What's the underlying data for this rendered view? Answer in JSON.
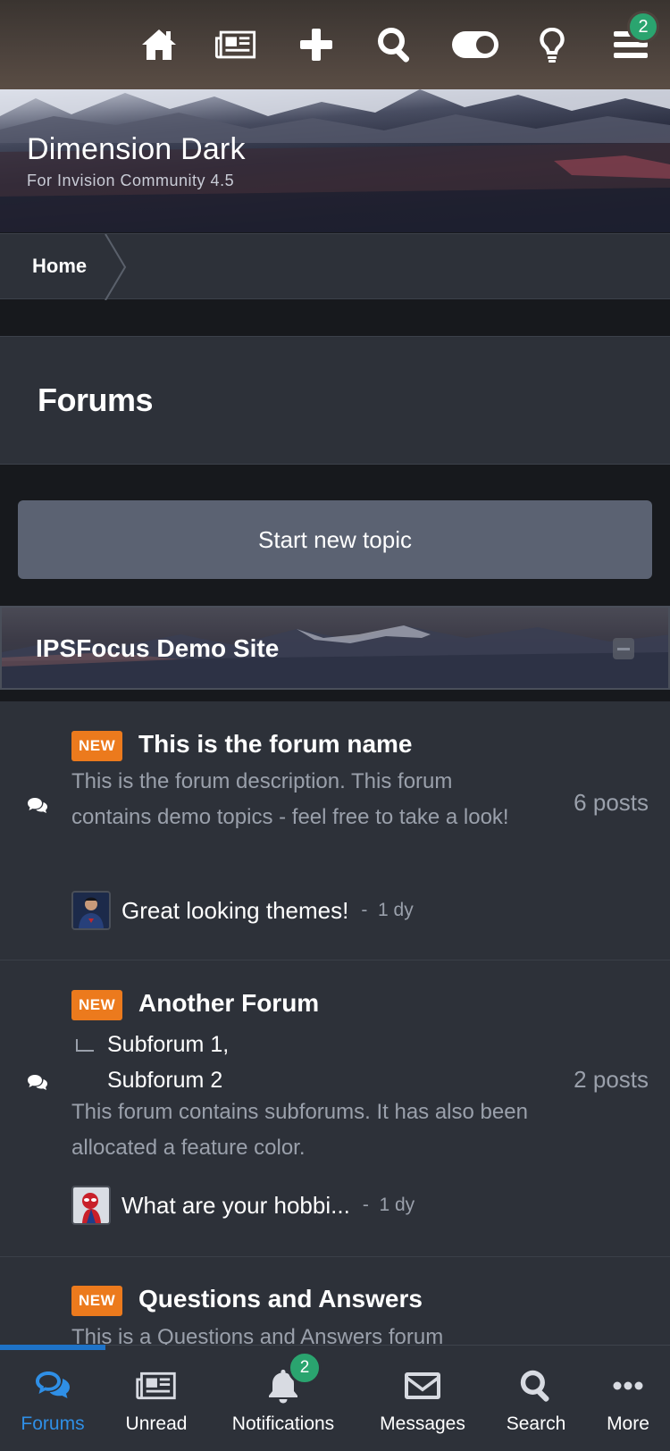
{
  "topbar": {
    "icons": [
      "home-icon",
      "newspaper-icon",
      "plus-icon",
      "search-icon",
      "toggle-icon",
      "lightbulb-icon",
      "menu-icon"
    ],
    "menu_badge": "2"
  },
  "hero": {
    "title": "Dimension Dark",
    "subtitle": "For Invision Community 4.5"
  },
  "breadcrumb": {
    "home": "Home"
  },
  "page": {
    "title": "Forums"
  },
  "actions": {
    "start_topic": "Start new topic"
  },
  "category": {
    "title": "IPSFocus Demo Site"
  },
  "forums": [
    {
      "badge": "NEW",
      "name": "This is the forum name",
      "description": "This is the forum description. This forum contains demo topics - feel free to take a look!",
      "posts": "6 posts",
      "last_post_title": "Great looking themes!",
      "last_post_time": "1 dy"
    },
    {
      "badge": "NEW",
      "name": "Another Forum",
      "subforums": [
        "Subforum 1,",
        "Subforum 2"
      ],
      "description": "This forum contains subforums. It has also been allocated a feature color.",
      "posts": "2 posts",
      "last_post_title": "What are your hobbi...",
      "last_post_time": "1 dy"
    },
    {
      "badge": "NEW",
      "name": "Questions and Answers",
      "description": "This is a Questions and Answers forum"
    }
  ],
  "bottom_nav": {
    "items": [
      {
        "label": "Forums",
        "icon": "chat-bubbles-icon"
      },
      {
        "label": "Unread",
        "icon": "newspaper-icon"
      },
      {
        "label": "Notifications",
        "icon": "bell-icon"
      },
      {
        "label": "Messages",
        "icon": "envelope-icon"
      },
      {
        "label": "Search",
        "icon": "search-icon"
      },
      {
        "label": "More",
        "icon": "ellipsis-icon"
      }
    ],
    "notifications_badge": "2"
  },
  "colors": {
    "accent_blue": "#2f8fe6",
    "badge_green": "#2aa46f",
    "new_badge_orange": "#ec7a1d",
    "panel_bg": "#2d3139",
    "page_bg": "#17191d"
  }
}
